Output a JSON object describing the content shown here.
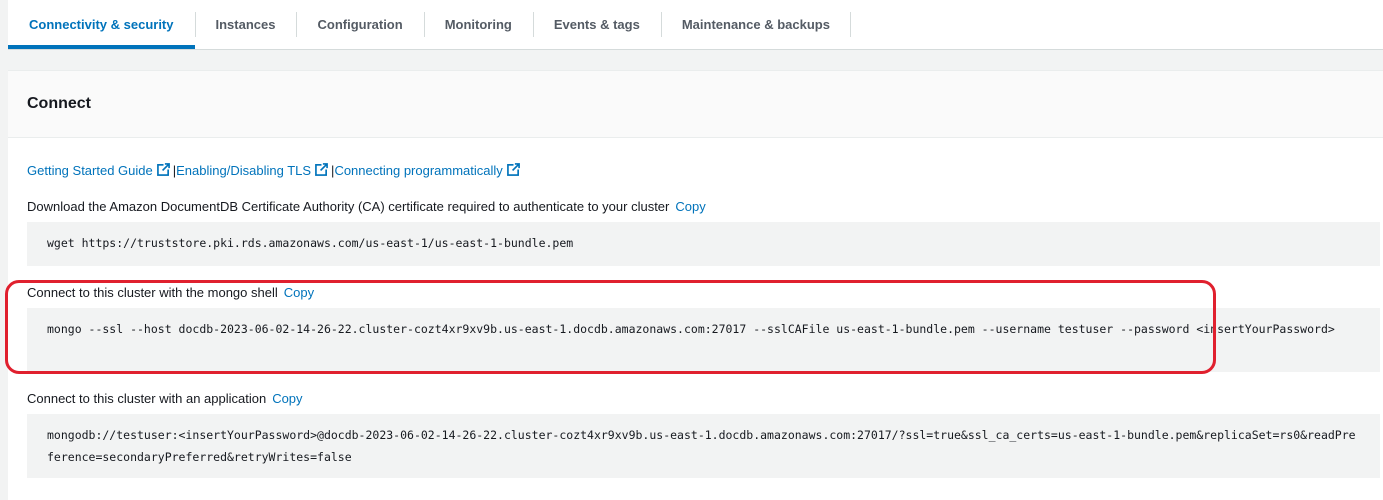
{
  "tabs": [
    {
      "label": "Connectivity & security",
      "active": true
    },
    {
      "label": "Instances",
      "active": false
    },
    {
      "label": "Configuration",
      "active": false
    },
    {
      "label": "Monitoring",
      "active": false
    },
    {
      "label": "Events & tags",
      "active": false
    },
    {
      "label": "Maintenance & backups",
      "active": false
    }
  ],
  "panel": {
    "title": "Connect",
    "links": [
      {
        "label": "Getting Started Guide"
      },
      {
        "label": "Enabling/Disabling TLS"
      },
      {
        "label": "Connecting programmatically"
      }
    ],
    "link_separator": "|",
    "copy_label": "Copy",
    "sections": [
      {
        "label": "Download the Amazon DocumentDB Certificate Authority (CA) certificate required to authenticate to your cluster",
        "code": "wget https://truststore.pki.rds.amazonaws.com/us-east-1/us-east-1-bundle.pem"
      },
      {
        "label": "Connect to this cluster with the mongo shell",
        "code": "mongo --ssl --host docdb-2023-06-02-14-26-22.cluster-cozt4xr9xv9b.us-east-1.docdb.amazonaws.com:27017 --sslCAFile us-east-1-bundle.pem --username testuser --password <insertYourPassword>"
      },
      {
        "label": "Connect to this cluster with an application",
        "code": "mongodb://testuser:<insertYourPassword>@docdb-2023-06-02-14-26-22.cluster-cozt4xr9xv9b.us-east-1.docdb.amazonaws.com:27017/?ssl=true&ssl_ca_certs=us-east-1-bundle.pem&replicaSet=rs0&readPreference=secondaryPreferred&retryWrites=false"
      }
    ]
  },
  "colors": {
    "accent": "#0073bb",
    "highlight": "#e0202e"
  }
}
